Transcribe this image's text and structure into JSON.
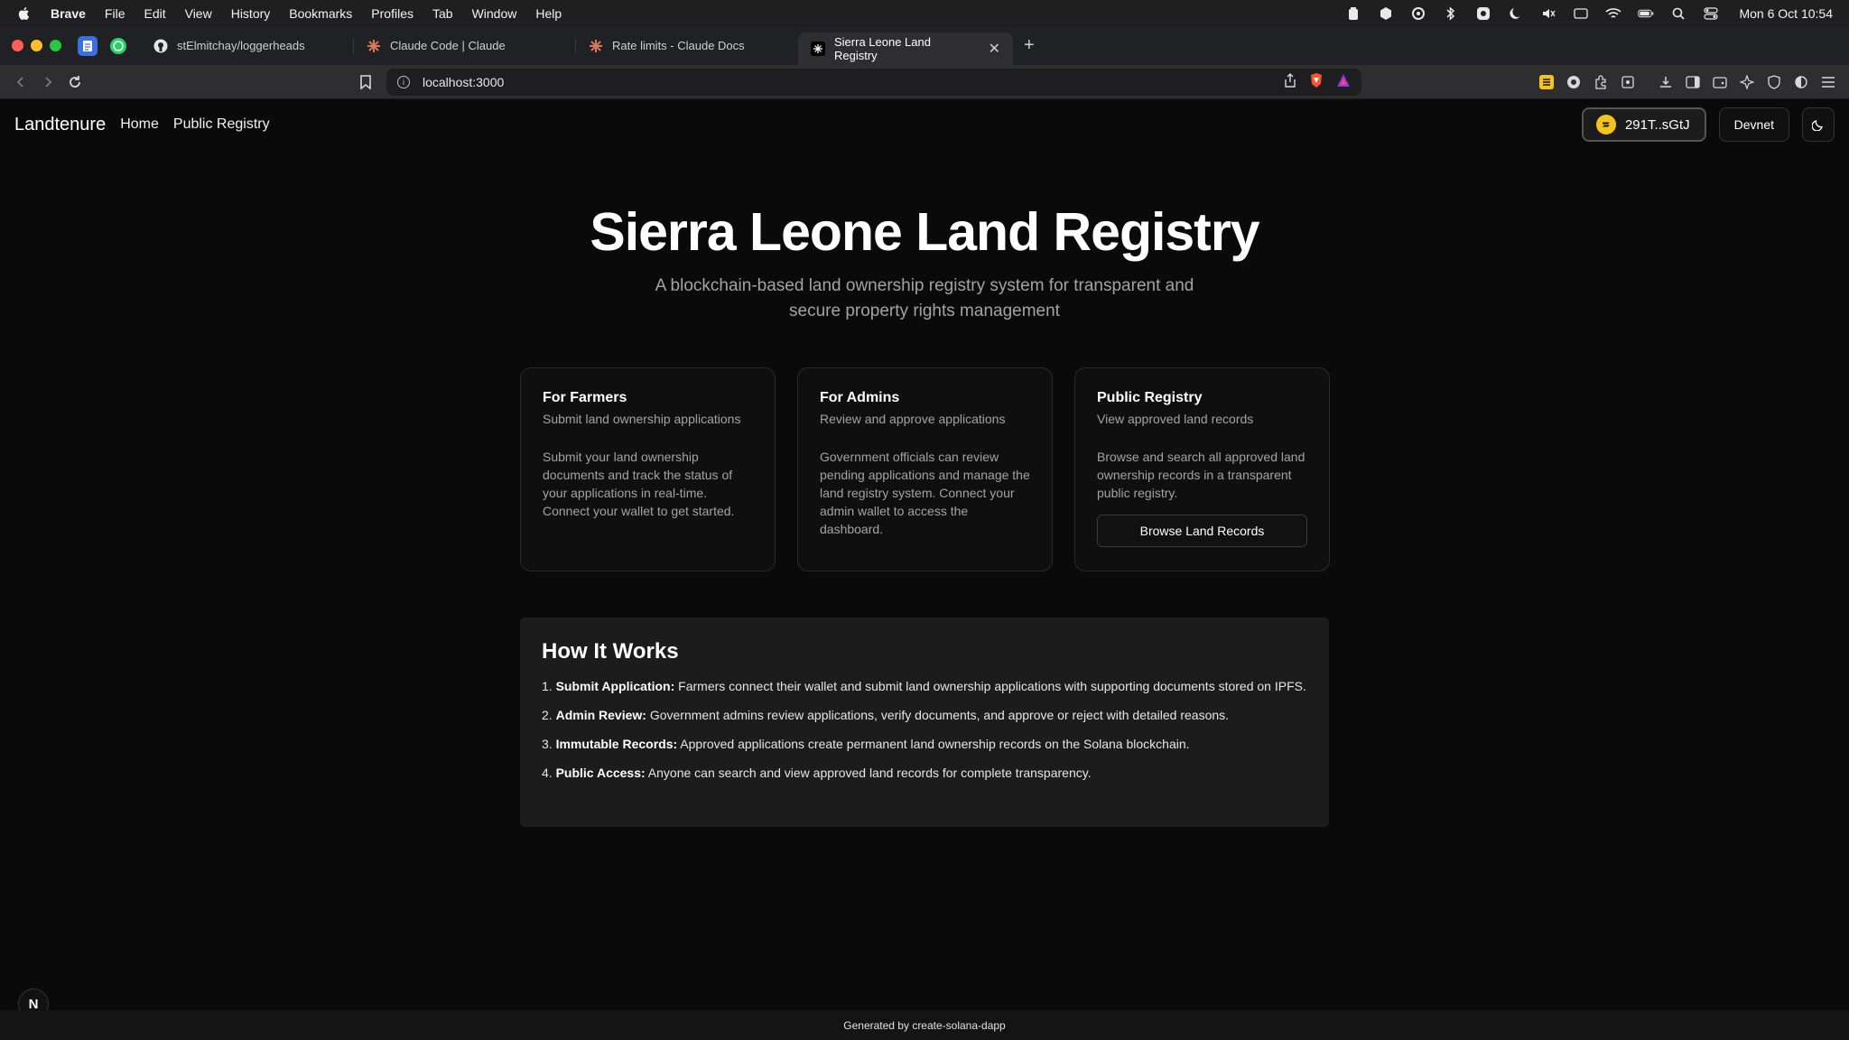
{
  "menubar": {
    "app": "Brave",
    "items": [
      "File",
      "Edit",
      "View",
      "History",
      "Bookmarks",
      "Profiles",
      "Tab",
      "Window",
      "Help"
    ],
    "clock": "Mon 6 Oct  10:54"
  },
  "tabs": [
    {
      "label": "stElmitchay/loggerheads",
      "icon": "github-icon"
    },
    {
      "label": "Claude Code | Claude",
      "icon": "claude-icon"
    },
    {
      "label": "Rate limits - Claude Docs",
      "icon": "claude-icon"
    },
    {
      "label": "Sierra Leone Land Registry",
      "icon": "page-icon",
      "active": true
    }
  ],
  "address": {
    "url": "localhost:3000"
  },
  "app": {
    "brand": "Landtenure",
    "nav": {
      "home": "Home",
      "public_registry": "Public Registry"
    },
    "wallet_label": "291T..sGtJ",
    "cluster_label": "Devnet",
    "hero": {
      "title": "Sierra Leone Land Registry",
      "subtitle": "A blockchain-based land ownership registry system for transparent and secure property rights management"
    },
    "cards": [
      {
        "title": "For Farmers",
        "subtitle": "Submit land ownership applications",
        "body": "Submit your land ownership documents and track the status of your applications in real-time. Connect your wallet to get started."
      },
      {
        "title": "For Admins",
        "subtitle": "Review and approve applications",
        "body": "Government officials can review pending applications and manage the land registry system. Connect your admin wallet to access the dashboard."
      },
      {
        "title": "Public Registry",
        "subtitle": "View approved land records",
        "body": "Browse and search all approved land ownership records in a transparent public registry.",
        "button": "Browse Land Records"
      }
    ],
    "how": {
      "title": "How It Works",
      "steps": [
        {
          "num": "1.",
          "bold": "Submit Application:",
          "text": " Farmers connect their wallet and submit land ownership applications with supporting documents stored on IPFS."
        },
        {
          "num": "2.",
          "bold": "Admin Review:",
          "text": " Government admins review applications, verify documents, and approve or reject with detailed reasons."
        },
        {
          "num": "3.",
          "bold": "Immutable Records:",
          "text": " Approved applications create permanent land ownership records on the Solana blockchain."
        },
        {
          "num": "4.",
          "bold": "Public Access:",
          "text": " Anyone can search and view approved land records for complete transparency."
        }
      ]
    },
    "badge": "N",
    "footer": "Generated by create-solana-dapp"
  }
}
